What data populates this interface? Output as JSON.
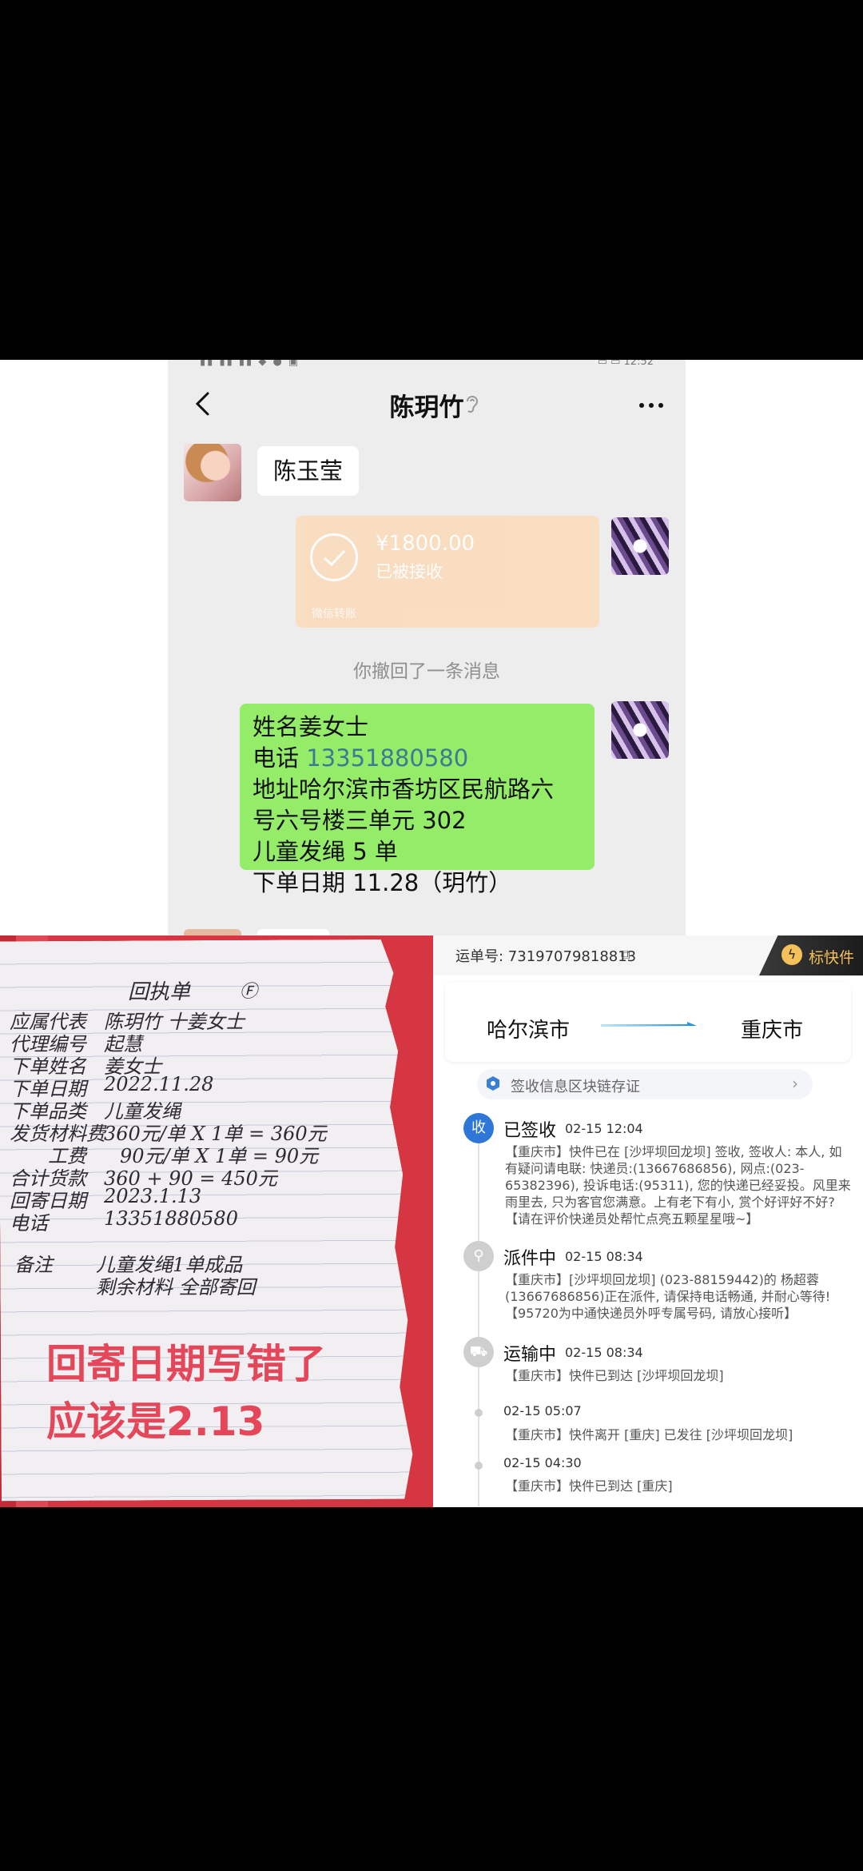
{
  "chat": {
    "title": "陈玥竹",
    "contact_name_message": "陈玉莹",
    "transfer": {
      "amount": "¥1800.00",
      "status": "已被接收",
      "footer": "微信转账"
    },
    "recall_notice": "你撤回了一条消息",
    "order_message": {
      "line1": "姓名姜女士",
      "phone_label": "电话 ",
      "phone": "13351880580",
      "line3": "地址哈尔滨市香坊区民航路六",
      "line4": "号六号楼三单元 302",
      "line5": "儿童发绳 5 单",
      "line6": "下单日期 11.28（玥竹）"
    }
  },
  "paper": {
    "title": "回执单",
    "rows": [
      {
        "label": "应属代表",
        "value": "陈玥竹 十姜女士"
      },
      {
        "label": "代理编号",
        "value": "起慧"
      },
      {
        "label": "下单姓名",
        "value": "姜女士"
      },
      {
        "label": "下单日期",
        "value": "2022.11.28"
      },
      {
        "label": "下单品类",
        "value": "儿童发绳"
      },
      {
        "label": "发货材料费",
        "value": "360元/单 X 1单 = 360元"
      },
      {
        "label": "工费",
        "value": "90元/单 X 1单 = 90元"
      },
      {
        "label": "合计货款",
        "value": "360 + 90 = 450元"
      },
      {
        "label": "回寄日期",
        "value": "2023.1.13"
      },
      {
        "label": "电话",
        "value": "13351880580"
      }
    ],
    "note_label": "备注",
    "note_line1": "儿童发绳1单成品",
    "note_line2": "剩余材料 全部寄回",
    "overlay_line1": "回寄日期写错了",
    "overlay_line2": "应该是2.13"
  },
  "logistics": {
    "waybill_label": "运单号: ",
    "waybill_number": "73197079818813",
    "badge": "标快件",
    "from_city": "哈尔滨市",
    "to_city": "重庆市",
    "chain_text": "签收信息区块链存证",
    "events": [
      {
        "icon": "收",
        "status": "已签收",
        "time": "02-15 12:04",
        "body": "【重庆市】快件已在 [沙坪坝回龙坝] 签收, 签收人: 本人, 如有疑问请电联: 快递员:(13667686856), 网点:(023-65382396), 投诉电话:(95311), 您的快递已经妥投。风里来雨里去, 只为客官您满意。上有老下有小, 赏个好评好不好? 【请在评价快递员处帮忙点亮五颗星星哦~】"
      },
      {
        "status": "派件中",
        "time": "02-15 08:34",
        "body": "【重庆市】[沙坪坝回龙坝] (023-88159442)的 杨超蓉(13667686856)正在派件, 请保持电话畅通, 并耐心等待!【95720为中通快递员外呼专属号码, 请放心接听】"
      },
      {
        "status": "运输中",
        "time": "02-15 08:34",
        "body": "【重庆市】快件已到达 [沙坪坝回龙坝]"
      },
      {
        "time": "02-15 05:07",
        "body": "【重庆市】快件离开 [重庆] 已发往 [沙坪坝回龙坝]"
      },
      {
        "time": "02-15 04:30",
        "body": "【重庆市】快件已到达 [重庆]"
      }
    ]
  },
  "colors": {
    "green_bubble": "#95ec69",
    "transfer_card": "#fbdcbc",
    "signed_blue": "#2e76b8",
    "overlay_red": "#e5475a"
  }
}
